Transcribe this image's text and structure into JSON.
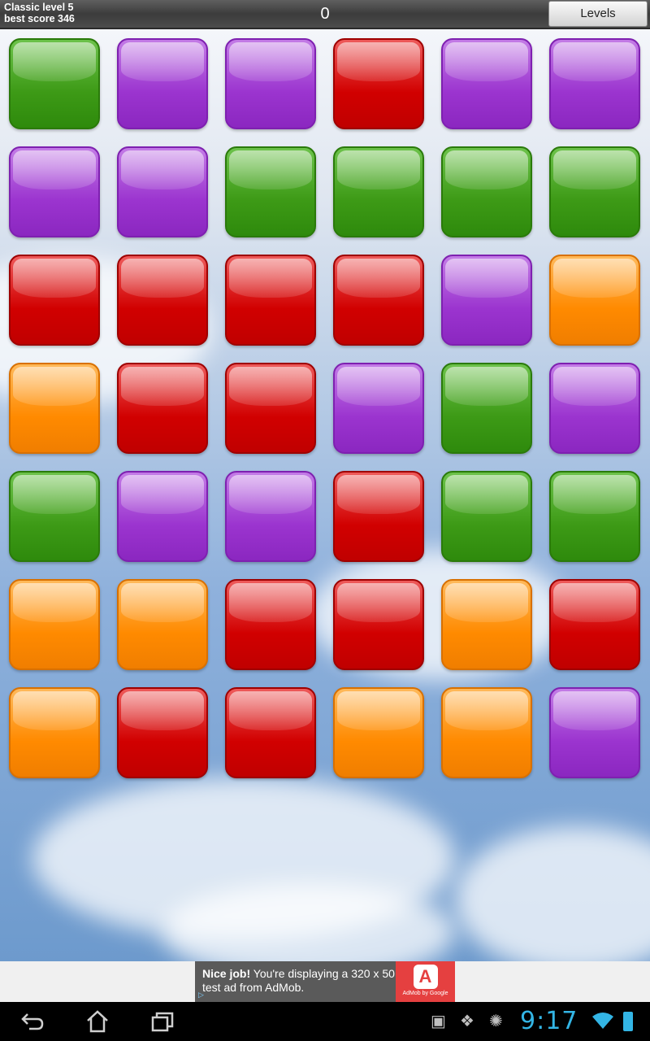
{
  "header": {
    "level_text": "Classic level 5",
    "best_text": "best score 346",
    "score": "0",
    "levels_label": "Levels"
  },
  "board": {
    "rows": [
      [
        "green",
        "purple",
        "purple",
        "red",
        "purple",
        "purple"
      ],
      [
        "purple",
        "purple",
        "green",
        "green",
        "green",
        "green"
      ],
      [
        "red",
        "red",
        "red",
        "red",
        "purple",
        "orange"
      ],
      [
        "orange",
        "red",
        "red",
        "purple",
        "green",
        "purple"
      ],
      [
        "green",
        "purple",
        "purple",
        "red",
        "green",
        "green"
      ],
      [
        "orange",
        "orange",
        "red",
        "red",
        "orange",
        "red"
      ],
      [
        "orange",
        "red",
        "red",
        "orange",
        "orange",
        "purple"
      ]
    ]
  },
  "ad": {
    "headline": "Nice job!",
    "body": " You're displaying a 320 x 50 test ad from AdMob.",
    "logo_glyph": "A",
    "logo_text": "AdMob by Google"
  },
  "nav": {
    "back_icon": "back-icon",
    "home_icon": "home-icon",
    "recents_icon": "recents-icon"
  },
  "status": {
    "time": "9:17"
  },
  "colors": {
    "green": "#3d9a16",
    "purple": "#9b34cf",
    "red": "#d10000",
    "orange": "#ff8a00",
    "clock": "#33b5e5"
  }
}
